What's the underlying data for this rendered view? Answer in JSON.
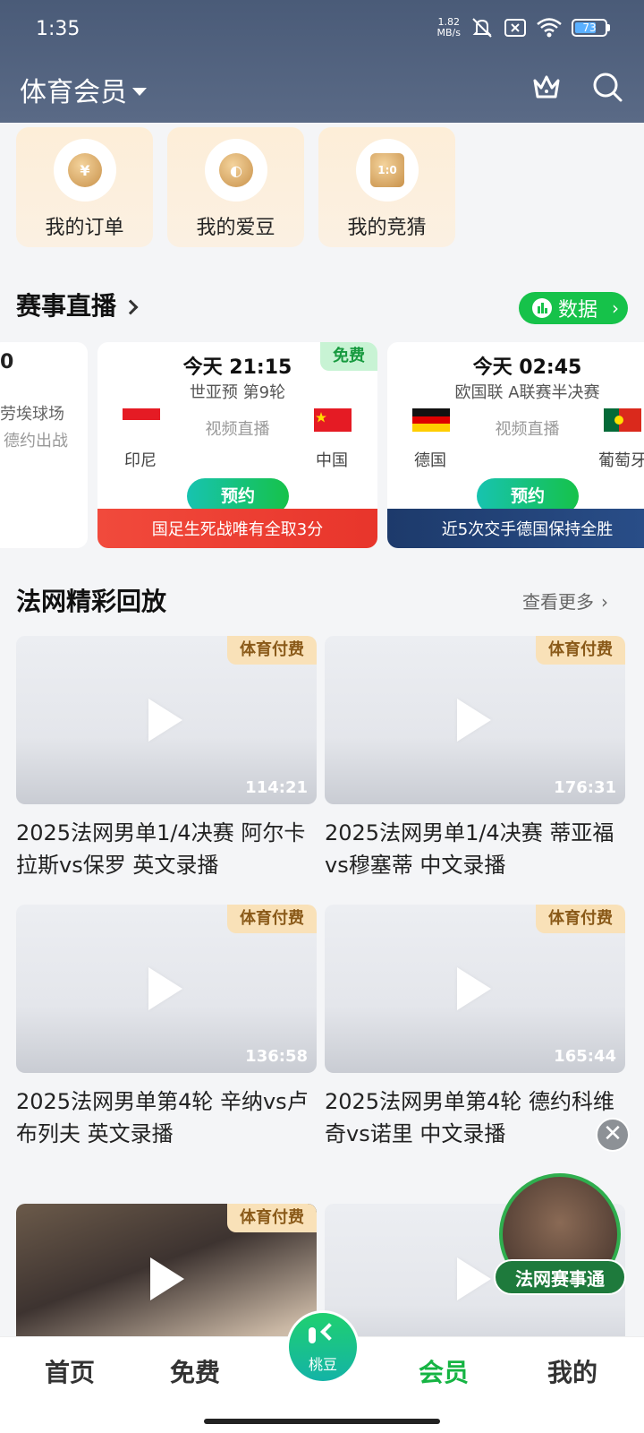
{
  "status_bar": {
    "time": "1:35",
    "speed_top": "1.82",
    "speed_unit": "MB/s",
    "battery": "73"
  },
  "header": {
    "title": "体育会员",
    "icons": [
      "crown-icon",
      "search-icon"
    ]
  },
  "quick_actions": [
    {
      "label": "我的订单",
      "icon": "yen-coin-icon",
      "glyph": "¥"
    },
    {
      "label": "我的爱豆",
      "icon": "bean-coin-icon",
      "glyph": "◐"
    },
    {
      "label": "我的竞猜",
      "icon": "score-calendar-icon",
      "glyph": "1:0"
    }
  ],
  "live_section": {
    "title": "赛事直播",
    "data_button": "数据"
  },
  "matches": [
    {
      "time": "0",
      "venue": "劳埃球场",
      "note": "德约出战"
    },
    {
      "time": "今天 21:15",
      "league": "世亚预 第9轮",
      "mode": "视频直播",
      "home": "印尼",
      "away": "中国",
      "tag": "免费",
      "button": "预约",
      "banner": "国足生死战唯有全取3分"
    },
    {
      "time": "今天 02:45",
      "league": "欧国联 A联赛半决赛",
      "mode": "视频直播",
      "home": "德国",
      "away": "葡萄牙",
      "button": "预约",
      "banner": "近5次交手德国保持全胜"
    }
  ],
  "replay_section": {
    "title": "法网精彩回放",
    "more": "查看更多"
  },
  "videos": [
    {
      "tag": "体育付费",
      "duration": "114:21",
      "title": "2025法网男单1/4决赛 阿尔卡拉斯vs保罗 英文录播"
    },
    {
      "tag": "体育付费",
      "duration": "176:31",
      "title": "2025法网男单1/4决赛 蒂亚福vs穆塞蒂 中文录播"
    },
    {
      "tag": "体育付费",
      "duration": "136:58",
      "title": "2025法网男单第4轮 辛纳vs卢布列夫 英文录播"
    },
    {
      "tag": "体育付费",
      "duration": "165:44",
      "title": "2025法网男单第4轮 德约科维奇vs诺里 中文录播"
    },
    {
      "tag": "体育付费"
    },
    {
      "tag": ""
    }
  ],
  "promo": {
    "label": "法网赛事通"
  },
  "nav": {
    "home": "首页",
    "free": "免费",
    "center": "桃豆",
    "member": "会员",
    "mine": "我的"
  },
  "colors": {
    "accent_green": "#16c24a",
    "header_bg": "#4a5b78",
    "pay_tag": "#f9e1b8"
  }
}
